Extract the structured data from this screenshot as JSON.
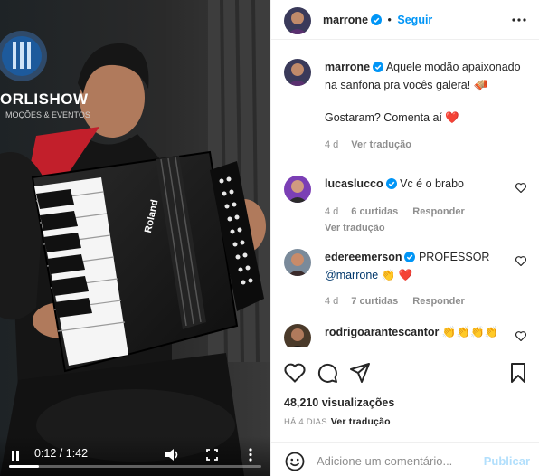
{
  "video": {
    "banner_line1": "ORLISHOW",
    "banner_line2": "MOÇÕES & EVENTOS",
    "accordion_brand": "Roland",
    "time": "0:12 / 1:42",
    "progress": 0.12
  },
  "header": {
    "username": "marrone",
    "separator": "•",
    "follow_label": "Seguir"
  },
  "caption": {
    "username": "marrone",
    "text": "Aquele modão apaixonado na sanfona pra vocês galera! 🪗",
    "line2": "Gostaram? Comenta aí ❤️",
    "age": "4 d",
    "translate": "Ver tradução"
  },
  "comments": [
    {
      "username": "lucaslucco",
      "text": "Vc é o brabo",
      "age": "4 d",
      "likes": "6 curtidas",
      "reply": "Responder",
      "translate": "Ver tradução"
    },
    {
      "username": "edereemerson",
      "text": "PROFESSOR",
      "mention": "@marrone",
      "emoji": "👏 ❤️",
      "age": "4 d",
      "likes": "7 curtidas",
      "reply": "Responder"
    },
    {
      "username": "rodrigoarantescantor",
      "text": "👏👏👏👏"
    }
  ],
  "stats": {
    "views": "48,210 visualizações",
    "ago": "HÁ 4 DIAS",
    "translate": "Ver tradução"
  },
  "add_comment": {
    "placeholder": "Adicione um comentário...",
    "publish": "Publicar"
  },
  "colors": {
    "accent": "#0095f6",
    "verified": "#0095f6",
    "publish_disabled": "#b2dffc",
    "meta_gray": "#8e8e8e"
  },
  "icons": [
    "pause-icon",
    "volume-icon",
    "fullscreen-icon",
    "more-vertical-icon",
    "verified-icon",
    "more-horizontal-icon",
    "heart-icon",
    "comment-icon",
    "share-icon",
    "bookmark-icon",
    "emoji-icon"
  ]
}
